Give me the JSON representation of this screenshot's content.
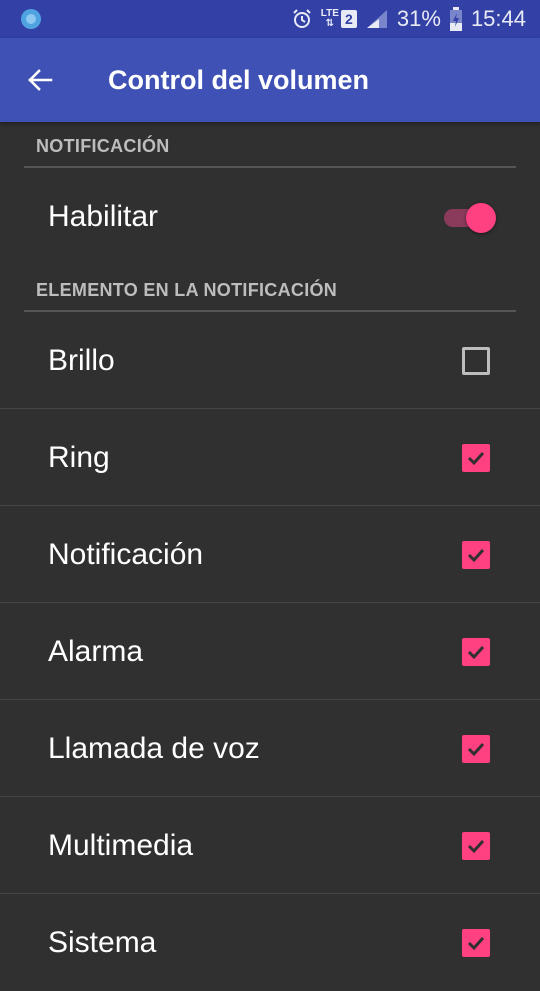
{
  "status_bar": {
    "battery_percent": "31%",
    "time": "15:44",
    "network": "LTE",
    "sim_slot": "2"
  },
  "app_bar": {
    "title": "Control del volumen"
  },
  "sections": [
    {
      "header": "NOTIFICACIÓN",
      "items": [
        {
          "label": "Habilitar",
          "control": "switch",
          "on": true
        }
      ]
    },
    {
      "header": "ELEMENTO EN LA NOTIFICACIÓN",
      "items": [
        {
          "label": "Brillo",
          "control": "checkbox",
          "checked": false
        },
        {
          "label": "Ring",
          "control": "checkbox",
          "checked": true
        },
        {
          "label": "Notificación",
          "control": "checkbox",
          "checked": true
        },
        {
          "label": "Alarma",
          "control": "checkbox",
          "checked": true
        },
        {
          "label": "Llamada de voz",
          "control": "checkbox",
          "checked": true
        },
        {
          "label": "Multimedia",
          "control": "checkbox",
          "checked": true
        },
        {
          "label": "Sistema",
          "control": "checkbox",
          "checked": true
        }
      ]
    }
  ],
  "colors": {
    "primary": "#3f51b5",
    "primary_dark": "#3341a6",
    "accent": "#ff4081",
    "background": "#303030"
  }
}
